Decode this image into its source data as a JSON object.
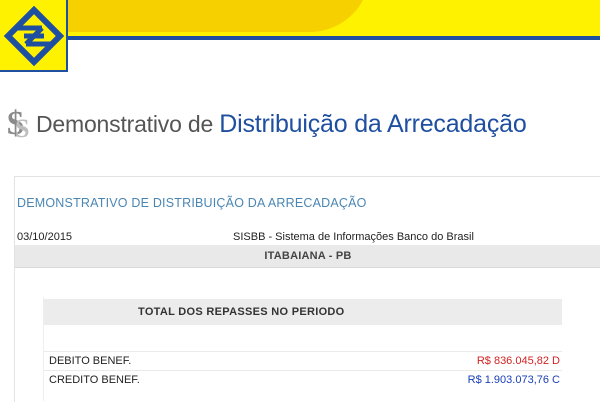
{
  "header": {
    "logo": "banco-do-brasil-logo",
    "colors": {
      "yellow": "#fff200",
      "blue": "#1f4fa0"
    }
  },
  "page_title": {
    "prefix": "Demonstrativo de ",
    "main": "Distribuição da Arrecadação"
  },
  "panel": {
    "heading": "DEMONSTRATIVO DE DISTRIBUIÇÃO DA ARRECADAÇÃO",
    "date": "03/10/2015",
    "system": "SISBB - Sistema de Informações Banco do Brasil",
    "city": "ITABAIANA - PB"
  },
  "totals": {
    "heading": "TOTAL DOS REPASSES NO PERIODO",
    "rows": [
      {
        "label": "DEBITO BENEF.",
        "value": "R$ 836.045,82 D",
        "color": "#d32222"
      },
      {
        "label": "CREDITO BENEF.",
        "value": "R$ 1.903.073,76 C",
        "color": "#1a3fb8"
      }
    ]
  }
}
